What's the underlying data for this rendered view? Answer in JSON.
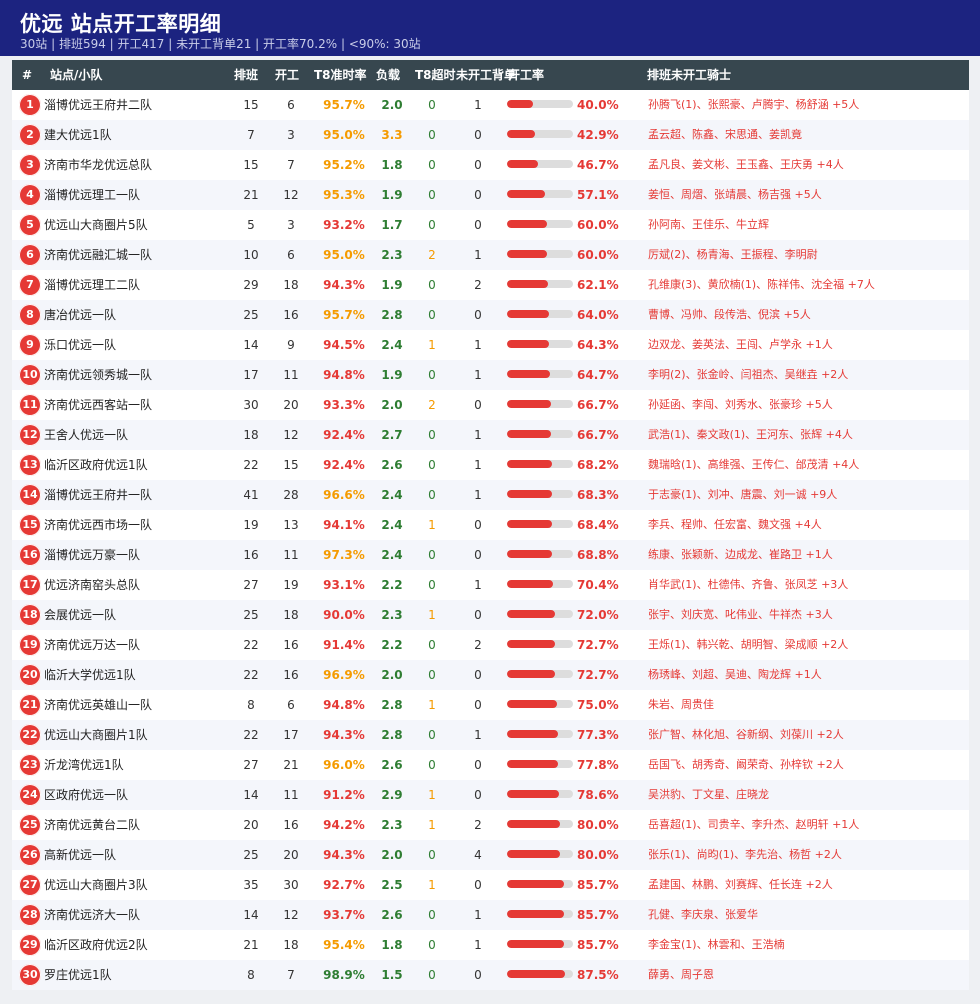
{
  "header": {
    "title": "优远  站点开工率明细",
    "subtitle": "30站 | 排班594 | 开工417 | 未开工背单21 | 开工率70.2% | <90%: 30站"
  },
  "columns": {
    "rank": "#",
    "name": "站点/小队",
    "scheduled": "排班",
    "working": "开工",
    "t8_rate": "T8准时率",
    "load": "负载",
    "t8_overtime": "T8超时",
    "not_working_backorders": "未开工背单",
    "work_rate": "开工率",
    "riders": "排班未开工骑士"
  },
  "colors": {
    "header_bg": "#1c2380",
    "thead_bg": "#37474f",
    "accent_red": "#e53935",
    "green": "#2e7d32",
    "orange": "#f59b00"
  },
  "rows": [
    {
      "rank": "1",
      "name": "淄博优远王府井二队",
      "sched": "15",
      "work": "6",
      "rate": "95.7%",
      "rate_color": "orange",
      "load": "2.0",
      "load_color": "green",
      "over": "0",
      "over_color": "green",
      "back": "1",
      "pct": "40.0%",
      "pct_value": 40.0,
      "riders": "孙腾飞(1)、张熙豪、卢腾宇、杨舒涵 +5人"
    },
    {
      "rank": "2",
      "name": "建大优远1队",
      "sched": "7",
      "work": "3",
      "rate": "95.0%",
      "rate_color": "orange",
      "load": "3.3",
      "load_color": "orange",
      "over": "0",
      "over_color": "green",
      "back": "0",
      "pct": "42.9%",
      "pct_value": 42.9,
      "riders": "孟云超、陈鑫、宋思通、姜凯竟"
    },
    {
      "rank": "3",
      "name": "济南市华龙优远总队",
      "sched": "15",
      "work": "7",
      "rate": "95.2%",
      "rate_color": "orange",
      "load": "1.8",
      "load_color": "green",
      "over": "0",
      "over_color": "green",
      "back": "0",
      "pct": "46.7%",
      "pct_value": 46.7,
      "riders": "孟凡良、姜文彬、王玉鑫、王庆勇 +4人"
    },
    {
      "rank": "4",
      "name": "淄博优远理工一队",
      "sched": "21",
      "work": "12",
      "rate": "95.3%",
      "rate_color": "orange",
      "load": "1.9",
      "load_color": "green",
      "over": "0",
      "over_color": "green",
      "back": "0",
      "pct": "57.1%",
      "pct_value": 57.1,
      "riders": "姜恒、周熠、张靖晨、杨吉强 +5人"
    },
    {
      "rank": "5",
      "name": "优远山大商圈片5队",
      "sched": "5",
      "work": "3",
      "rate": "93.2%",
      "rate_color": "red",
      "load": "1.7",
      "load_color": "green",
      "over": "0",
      "over_color": "green",
      "back": "0",
      "pct": "60.0%",
      "pct_value": 60.0,
      "riders": "孙阿南、王佳乐、牛立辉"
    },
    {
      "rank": "6",
      "name": "济南优远融汇城一队",
      "sched": "10",
      "work": "6",
      "rate": "95.0%",
      "rate_color": "orange",
      "load": "2.3",
      "load_color": "green",
      "over": "2",
      "over_color": "orange",
      "back": "1",
      "pct": "60.0%",
      "pct_value": 60.0,
      "riders": "厉斌(2)、杨青海、王振程、李明尉"
    },
    {
      "rank": "7",
      "name": "淄博优远理工二队",
      "sched": "29",
      "work": "18",
      "rate": "94.3%",
      "rate_color": "red",
      "load": "1.9",
      "load_color": "green",
      "over": "0",
      "over_color": "green",
      "back": "2",
      "pct": "62.1%",
      "pct_value": 62.1,
      "riders": "孔维康(3)、黄欣楠(1)、陈祥伟、沈全福 +7人"
    },
    {
      "rank": "8",
      "name": "唐冶优远一队",
      "sched": "25",
      "work": "16",
      "rate": "95.7%",
      "rate_color": "orange",
      "load": "2.8",
      "load_color": "green",
      "over": "0",
      "over_color": "green",
      "back": "0",
      "pct": "64.0%",
      "pct_value": 64.0,
      "riders": "曹博、冯帅、段传浩、倪滨 +5人"
    },
    {
      "rank": "9",
      "name": "泺口优远一队",
      "sched": "14",
      "work": "9",
      "rate": "94.5%",
      "rate_color": "red",
      "load": "2.4",
      "load_color": "green",
      "over": "1",
      "over_color": "orange",
      "back": "1",
      "pct": "64.3%",
      "pct_value": 64.3,
      "riders": "边双龙、姜英法、王闯、卢学永 +1人"
    },
    {
      "rank": "10",
      "name": "济南优远领秀城一队",
      "sched": "17",
      "work": "11",
      "rate": "94.8%",
      "rate_color": "red",
      "load": "1.9",
      "load_color": "green",
      "over": "0",
      "over_color": "green",
      "back": "1",
      "pct": "64.7%",
      "pct_value": 64.7,
      "riders": "李明(2)、张金岭、闫祖杰、吴继垚 +2人"
    },
    {
      "rank": "11",
      "name": "济南优远西客站一队",
      "sched": "30",
      "work": "20",
      "rate": "93.3%",
      "rate_color": "red",
      "load": "2.0",
      "load_color": "green",
      "over": "2",
      "over_color": "orange",
      "back": "0",
      "pct": "66.7%",
      "pct_value": 66.7,
      "riders": "孙延函、李闯、刘秀水、张豪珍 +5人"
    },
    {
      "rank": "12",
      "name": "王舍人优远一队",
      "sched": "18",
      "work": "12",
      "rate": "92.4%",
      "rate_color": "red",
      "load": "2.7",
      "load_color": "green",
      "over": "0",
      "over_color": "green",
      "back": "1",
      "pct": "66.7%",
      "pct_value": 66.7,
      "riders": "武浩(1)、秦文政(1)、王河东、张辉 +4人"
    },
    {
      "rank": "13",
      "name": "临沂区政府优远1队",
      "sched": "22",
      "work": "15",
      "rate": "92.4%",
      "rate_color": "red",
      "load": "2.6",
      "load_color": "green",
      "over": "0",
      "over_color": "green",
      "back": "1",
      "pct": "68.2%",
      "pct_value": 68.2,
      "riders": "魏瑞晗(1)、高维强、王传仁、邰茂清 +4人"
    },
    {
      "rank": "14",
      "name": "淄博优远王府井一队",
      "sched": "41",
      "work": "28",
      "rate": "96.6%",
      "rate_color": "orange",
      "load": "2.4",
      "load_color": "green",
      "over": "0",
      "over_color": "green",
      "back": "1",
      "pct": "68.3%",
      "pct_value": 68.3,
      "riders": "于志豪(1)、刘冲、唐震、刘一诚 +9人"
    },
    {
      "rank": "15",
      "name": "济南优远西市场一队",
      "sched": "19",
      "work": "13",
      "rate": "94.1%",
      "rate_color": "red",
      "load": "2.4",
      "load_color": "green",
      "over": "1",
      "over_color": "orange",
      "back": "0",
      "pct": "68.4%",
      "pct_value": 68.4,
      "riders": "李兵、程帅、任宏富、魏文强 +4人"
    },
    {
      "rank": "16",
      "name": "淄博优远万豪一队",
      "sched": "16",
      "work": "11",
      "rate": "97.3%",
      "rate_color": "orange",
      "load": "2.4",
      "load_color": "green",
      "over": "0",
      "over_color": "green",
      "back": "0",
      "pct": "68.8%",
      "pct_value": 68.8,
      "riders": "练康、张颖新、边成龙、崔路卫 +1人"
    },
    {
      "rank": "17",
      "name": "优远济南窑头总队",
      "sched": "27",
      "work": "19",
      "rate": "93.1%",
      "rate_color": "red",
      "load": "2.2",
      "load_color": "green",
      "over": "0",
      "over_color": "green",
      "back": "1",
      "pct": "70.4%",
      "pct_value": 70.4,
      "riders": "肖华武(1)、杜德伟、齐鲁、张凤芝 +3人"
    },
    {
      "rank": "18",
      "name": "会展优远一队",
      "sched": "25",
      "work": "18",
      "rate": "90.0%",
      "rate_color": "red",
      "load": "2.3",
      "load_color": "green",
      "over": "1",
      "over_color": "orange",
      "back": "0",
      "pct": "72.0%",
      "pct_value": 72.0,
      "riders": "张宇、刘庆宽、叱伟业、牛祥杰 +3人"
    },
    {
      "rank": "19",
      "name": "济南优远万达一队",
      "sched": "22",
      "work": "16",
      "rate": "91.4%",
      "rate_color": "red",
      "load": "2.2",
      "load_color": "green",
      "over": "0",
      "over_color": "green",
      "back": "2",
      "pct": "72.7%",
      "pct_value": 72.7,
      "riders": "王烁(1)、韩兴乾、胡明智、梁成顺 +2人"
    },
    {
      "rank": "20",
      "name": "临沂大学优远1队",
      "sched": "22",
      "work": "16",
      "rate": "96.9%",
      "rate_color": "orange",
      "load": "2.0",
      "load_color": "green",
      "over": "0",
      "over_color": "green",
      "back": "0",
      "pct": "72.7%",
      "pct_value": 72.7,
      "riders": "杨琇峰、刘超、吴迪、陶龙辉 +1人"
    },
    {
      "rank": "21",
      "name": "济南优远英雄山一队",
      "sched": "8",
      "work": "6",
      "rate": "94.8%",
      "rate_color": "red",
      "load": "2.8",
      "load_color": "green",
      "over": "1",
      "over_color": "orange",
      "back": "0",
      "pct": "75.0%",
      "pct_value": 75.0,
      "riders": "朱岩、周贵佳"
    },
    {
      "rank": "22",
      "name": "优远山大商圈片1队",
      "sched": "22",
      "work": "17",
      "rate": "94.3%",
      "rate_color": "red",
      "load": "2.8",
      "load_color": "green",
      "over": "0",
      "over_color": "green",
      "back": "1",
      "pct": "77.3%",
      "pct_value": 77.3,
      "riders": "张广智、林化旭、谷新纲、刘葆川 +2人"
    },
    {
      "rank": "23",
      "name": "沂龙湾优远1队",
      "sched": "27",
      "work": "21",
      "rate": "96.0%",
      "rate_color": "orange",
      "load": "2.6",
      "load_color": "green",
      "over": "0",
      "over_color": "green",
      "back": "0",
      "pct": "77.8%",
      "pct_value": 77.8,
      "riders": "岳国飞、胡秀奇、阚荣奇、孙梓钦 +2人"
    },
    {
      "rank": "24",
      "name": "区政府优远一队",
      "sched": "14",
      "work": "11",
      "rate": "91.2%",
      "rate_color": "red",
      "load": "2.9",
      "load_color": "green",
      "over": "1",
      "over_color": "orange",
      "back": "0",
      "pct": "78.6%",
      "pct_value": 78.6,
      "riders": "吴洪豹、丁文星、庄晓龙"
    },
    {
      "rank": "25",
      "name": "济南优远黄台二队",
      "sched": "20",
      "work": "16",
      "rate": "94.2%",
      "rate_color": "red",
      "load": "2.3",
      "load_color": "green",
      "over": "1",
      "over_color": "orange",
      "back": "2",
      "pct": "80.0%",
      "pct_value": 80.0,
      "riders": "岳喜超(1)、司贵辛、李升杰、赵明轩 +1人"
    },
    {
      "rank": "26",
      "name": "高新优远一队",
      "sched": "25",
      "work": "20",
      "rate": "94.3%",
      "rate_color": "red",
      "load": "2.0",
      "load_color": "green",
      "over": "0",
      "over_color": "green",
      "back": "4",
      "pct": "80.0%",
      "pct_value": 80.0,
      "riders": "张乐(1)、尚昀(1)、李先治、杨哲 +2人"
    },
    {
      "rank": "27",
      "name": "优远山大商圈片3队",
      "sched": "35",
      "work": "30",
      "rate": "92.7%",
      "rate_color": "red",
      "load": "2.5",
      "load_color": "green",
      "over": "1",
      "over_color": "orange",
      "back": "0",
      "pct": "85.7%",
      "pct_value": 85.7,
      "riders": "孟建国、林鹏、刘赛辉、任长连 +2人"
    },
    {
      "rank": "28",
      "name": "济南优远济大一队",
      "sched": "14",
      "work": "12",
      "rate": "93.7%",
      "rate_color": "red",
      "load": "2.6",
      "load_color": "green",
      "over": "0",
      "over_color": "green",
      "back": "1",
      "pct": "85.7%",
      "pct_value": 85.7,
      "riders": "孔健、李庆泉、张爱华"
    },
    {
      "rank": "29",
      "name": "临沂区政府优远2队",
      "sched": "21",
      "work": "18",
      "rate": "95.4%",
      "rate_color": "orange",
      "load": "1.8",
      "load_color": "green",
      "over": "0",
      "over_color": "green",
      "back": "1",
      "pct": "85.7%",
      "pct_value": 85.7,
      "riders": "李金宝(1)、林雲和、王浩楠"
    },
    {
      "rank": "30",
      "name": "罗庄优远1队",
      "sched": "8",
      "work": "7",
      "rate": "98.9%",
      "rate_color": "green",
      "load": "1.5",
      "load_color": "green",
      "over": "0",
      "over_color": "green",
      "back": "0",
      "pct": "87.5%",
      "pct_value": 87.5,
      "riders": "薛勇、周子恩"
    }
  ]
}
